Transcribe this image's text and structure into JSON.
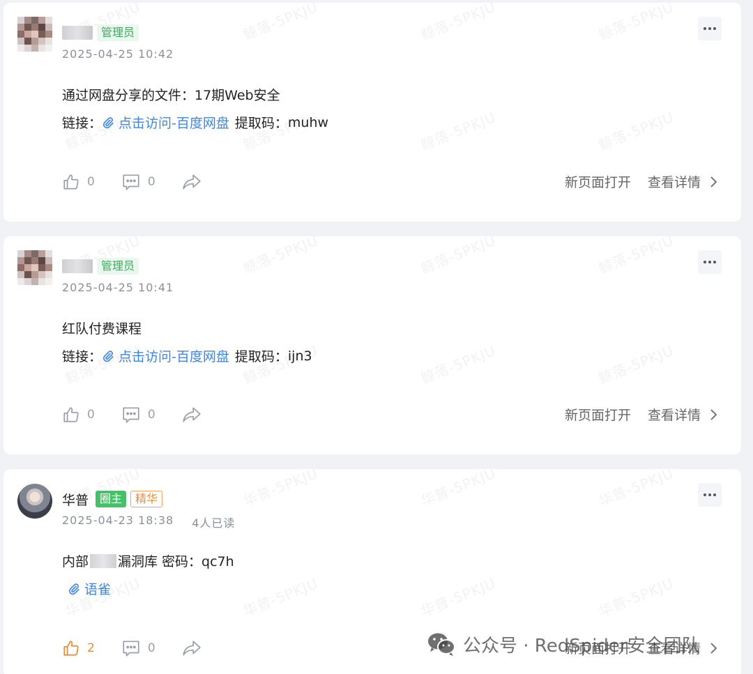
{
  "posts": [
    {
      "name": "",
      "badges": [
        "管理员"
      ],
      "date": "2025-04-25 10:42",
      "reads": "",
      "title": "通过网盘分享的文件：17期Web安全",
      "link_prefix": "链接：",
      "link_text": "点击访问-百度网盘",
      "code_label": "提取码：",
      "code": "muhw",
      "likes": "0",
      "comments": "0",
      "open_new_page": "新页面打开",
      "view_details": "查看详情",
      "watermark": "鲸落-5PKJU"
    },
    {
      "name": "",
      "badges": [
        "管理员"
      ],
      "date": "2025-04-25 10:41",
      "reads": "",
      "title": "红队付费课程",
      "link_prefix": "链接：",
      "link_text": "点击访问-百度网盘",
      "code_label": "提取码：",
      "code": "ijn3",
      "likes": "0",
      "comments": "0",
      "open_new_page": "新页面打开",
      "view_details": "查看详情",
      "watermark": "鲸落-5PKJU"
    },
    {
      "name": "华普",
      "badges": [
        "圈主",
        "精华"
      ],
      "date": "2025-04-23 18:38",
      "reads": "4人已读",
      "title_before": "内部",
      "title_after": "漏洞库 密码：qc7h",
      "link_text": "语雀",
      "likes": "2",
      "comments": "0",
      "open_new_page": "新页面打开",
      "view_details": "查看详情",
      "watermark": "华普-5PKJU"
    }
  ],
  "footer_watermark": "公众号 · RedSpider安全团队",
  "colors": {
    "link": "#3d86e0",
    "admin_badge": "#3daa5c",
    "owner_badge": "#48c06a",
    "elite_badge": "#f08a2e",
    "liked": "#e88b34"
  },
  "icons": [
    "more-dots-icon",
    "paperclip-icon",
    "thumbs-up-icon",
    "comment-icon",
    "share-icon",
    "chevron-right-icon",
    "wechat-icon"
  ]
}
